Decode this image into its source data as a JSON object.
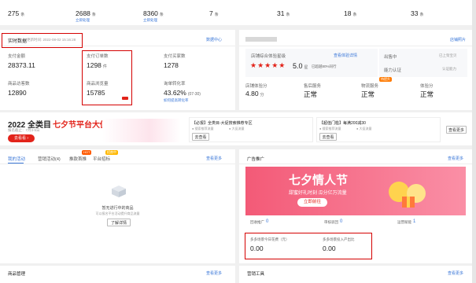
{
  "top_stats": [
    {
      "value": "275",
      "unit": "条",
      "sub": ""
    },
    {
      "value": "2688",
      "unit": "条",
      "sub": "立即处理"
    },
    {
      "value": "8360",
      "unit": "条",
      "sub": "立即处理"
    },
    {
      "value": "7",
      "unit": "条",
      "sub": ""
    },
    {
      "value": "31",
      "unit": "条",
      "sub": ""
    },
    {
      "value": "18",
      "unit": "条",
      "sub": ""
    },
    {
      "value": "33",
      "unit": "条",
      "sub": ""
    }
  ],
  "realtime": {
    "title": "实时数据",
    "update_time": "更新时间: 2022-08-02 15:16:28",
    "link": "数据中心",
    "metrics": [
      {
        "label": "支付金额",
        "value": "28373.11"
      },
      {
        "label": "支付订单数",
        "value": "1298",
        "unit": "件"
      },
      {
        "label": "支付买家数",
        "value": "1278"
      },
      {
        "label": "商品访客数",
        "value": "12890"
      },
      {
        "label": "商品浏览量",
        "value": "15785"
      },
      {
        "label": "询单转化率",
        "value": "43.62%",
        "extra": "(07-30)",
        "link": "如何提高转化率"
      }
    ]
  },
  "shop": {
    "link": "店铺照片",
    "rating_title": "店铺综合体验星级",
    "rating_link": "查看体验详情",
    "rating_value": "5.0",
    "rating_unit": "星",
    "rating_note": "已超越80%同行",
    "stars": "★★★★★",
    "side": [
      {
        "label": "出售中",
        "link": "已上架宝贝"
      },
      {
        "label": "能力认证",
        "link": "认证能力"
      }
    ],
    "scores": [
      {
        "label": "店铺体验分",
        "value": "4.80",
        "unit": "分"
      },
      {
        "label": "售后服务",
        "value": "正常"
      },
      {
        "label": "物流服务",
        "value": "正常",
        "badge": "待提升"
      },
      {
        "label": "体验分",
        "value": "正常"
      }
    ]
  },
  "promo": {
    "title_prefix": "2022 全类目",
    "title_highlight": "七夕节平台大促",
    "sub": "报名截止：7月3-5日",
    "cta": "去看看",
    "item1": {
      "title": "【必报】全类目-大促搜索推荐专区",
      "line1": "● 搜索推荐流量",
      "line2": "● 大促流量",
      "btn": "去查看"
    },
    "item2": {
      "title": "【超值门槛】每满200减30",
      "line1": "● 搜索推荐流量",
      "line2": "● 大促流量",
      "btn": "去查看"
    },
    "more": "查看更多"
  },
  "activity": {
    "tabs": [
      "我的活动",
      "营销活动(4)",
      "推款首推",
      "平台招标"
    ],
    "tab_badges": [
      "",
      "",
      "HOT",
      "招商中"
    ],
    "link": "查看更多",
    "empty_title": "暂无进行中的商品",
    "empty_sub": "可以报名平台活动提升商品流量",
    "empty_btn": "了解详情"
  },
  "ads": {
    "title": "广告推广",
    "link": "查看更多",
    "banner_title": "七夕情人节",
    "banner_sub": "甜蜜好礼时刻 瓜分亿万流量",
    "banner_cta": "立即前往",
    "stats": [
      {
        "label": "回收推广",
        "value": "0"
      },
      {
        "label": "审核驳回",
        "value": "0"
      },
      {
        "label": "运营赋能",
        "value": "1"
      }
    ],
    "metrics": [
      {
        "label": "多多场景今日花费（元）",
        "value": "0.00"
      },
      {
        "label": "多多场景投入产出比",
        "value": "0.00"
      }
    ]
  },
  "bottom": {
    "left": "商品管理",
    "left_link": "查看更多",
    "right": "营销工具",
    "right_link": "查看更多"
  }
}
